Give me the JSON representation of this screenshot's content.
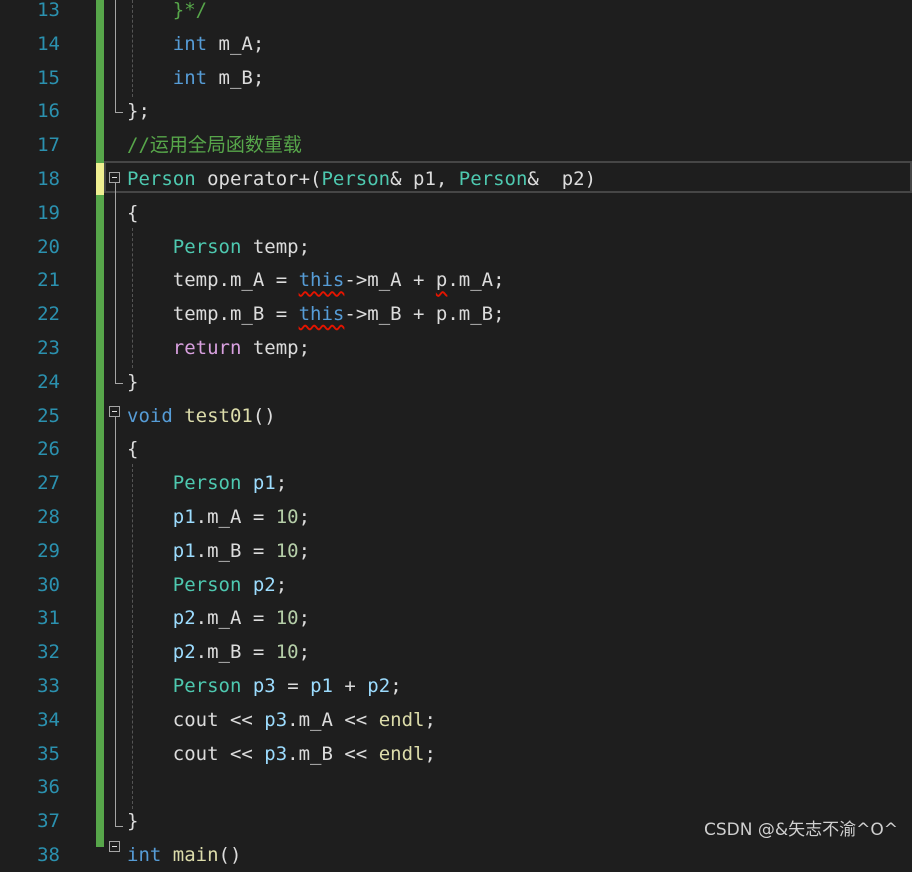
{
  "line_numbers": [
    "13",
    "14",
    "15",
    "16",
    "17",
    "18",
    "19",
    "20",
    "21",
    "22",
    "23",
    "24",
    "25",
    "26",
    "27",
    "28",
    "29",
    "30",
    "31",
    "32",
    "33",
    "34",
    "35",
    "36",
    "37",
    "38"
  ],
  "lines": [
    [
      {
        "t": "    "
      },
      {
        "t": "}*/",
        "c": "cmt"
      }
    ],
    [
      {
        "t": "    "
      },
      {
        "t": "int",
        "c": "kw"
      },
      {
        "t": " m_A;"
      }
    ],
    [
      {
        "t": "    "
      },
      {
        "t": "int",
        "c": "kw"
      },
      {
        "t": " m_B;"
      }
    ],
    [
      {
        "t": "};"
      }
    ],
    [
      {
        "t": "//运用全局函数重载",
        "c": "cmt"
      }
    ],
    [
      {
        "t": "Person",
        "c": "type"
      },
      {
        "t": " operator+(",
        "c": "plain"
      },
      {
        "t": "Person",
        "c": "type"
      },
      {
        "t": "& p1, "
      },
      {
        "t": "Person",
        "c": "type"
      },
      {
        "t": "&  p2)"
      }
    ],
    [
      {
        "t": "{"
      }
    ],
    [
      {
        "t": "    "
      },
      {
        "t": "Person",
        "c": "type"
      },
      {
        "t": " temp;"
      }
    ],
    [
      {
        "t": "    "
      },
      {
        "t": "temp",
        "c": "plain"
      },
      {
        "t": ".m_A = "
      },
      {
        "t": "this",
        "c": "kw",
        "sq": true
      },
      {
        "t": "->m_A + "
      },
      {
        "t": "p",
        "sq": true
      },
      {
        "t": ".m_A;"
      }
    ],
    [
      {
        "t": "    "
      },
      {
        "t": "temp",
        "c": "plain"
      },
      {
        "t": ".m_B = "
      },
      {
        "t": "this",
        "c": "kw",
        "sq": true
      },
      {
        "t": "->m_B + p.m_B;"
      }
    ],
    [
      {
        "t": "    "
      },
      {
        "t": "return",
        "c": "ctl"
      },
      {
        "t": " temp;"
      }
    ],
    [
      {
        "t": "}"
      }
    ],
    [
      {
        "t": "void",
        "c": "kw"
      },
      {
        "t": " "
      },
      {
        "t": "test01",
        "c": "fn"
      },
      {
        "t": "()"
      }
    ],
    [
      {
        "t": "{"
      }
    ],
    [
      {
        "t": "    "
      },
      {
        "t": "Person",
        "c": "type"
      },
      {
        "t": " "
      },
      {
        "t": "p1",
        "c": "var"
      },
      {
        "t": ";"
      }
    ],
    [
      {
        "t": "    "
      },
      {
        "t": "p1",
        "c": "var"
      },
      {
        "t": ".m_A = "
      },
      {
        "t": "10",
        "c": "num"
      },
      {
        "t": ";"
      }
    ],
    [
      {
        "t": "    "
      },
      {
        "t": "p1",
        "c": "var"
      },
      {
        "t": ".m_B = "
      },
      {
        "t": "10",
        "c": "num"
      },
      {
        "t": ";"
      }
    ],
    [
      {
        "t": "    "
      },
      {
        "t": "Person",
        "c": "type"
      },
      {
        "t": " "
      },
      {
        "t": "p2",
        "c": "var"
      },
      {
        "t": ";"
      }
    ],
    [
      {
        "t": "    "
      },
      {
        "t": "p2",
        "c": "var"
      },
      {
        "t": ".m_A = "
      },
      {
        "t": "10",
        "c": "num"
      },
      {
        "t": ";"
      }
    ],
    [
      {
        "t": "    "
      },
      {
        "t": "p2",
        "c": "var"
      },
      {
        "t": ".m_B = "
      },
      {
        "t": "10",
        "c": "num"
      },
      {
        "t": ";"
      }
    ],
    [
      {
        "t": "    "
      },
      {
        "t": "Person",
        "c": "type"
      },
      {
        "t": " "
      },
      {
        "t": "p3",
        "c": "var"
      },
      {
        "t": " = "
      },
      {
        "t": "p1",
        "c": "var"
      },
      {
        "t": " + "
      },
      {
        "t": "p2",
        "c": "var"
      },
      {
        "t": ";"
      }
    ],
    [
      {
        "t": "    cout << "
      },
      {
        "t": "p3",
        "c": "var"
      },
      {
        "t": ".m_A << "
      },
      {
        "t": "endl",
        "c": "fn"
      },
      {
        "t": ";"
      }
    ],
    [
      {
        "t": "    cout << "
      },
      {
        "t": "p3",
        "c": "var"
      },
      {
        "t": ".m_B << "
      },
      {
        "t": "endl",
        "c": "fn"
      },
      {
        "t": ";"
      }
    ],
    [
      {
        "t": ""
      }
    ],
    [
      {
        "t": "}"
      }
    ],
    [
      {
        "t": "int",
        "c": "kw"
      },
      {
        "t": " "
      },
      {
        "t": "main",
        "c": "fn"
      },
      {
        "t": "()"
      }
    ]
  ],
  "watermark": "CSDN @&矢志不渝^O^",
  "colors": {
    "background": "#1e1e1e",
    "line_number": "#2b91af",
    "keyword": "#569cd6",
    "type": "#4ec9b0",
    "comment": "#57a64a",
    "change_saved": "#57a64a",
    "change_unsaved": "#efef91"
  }
}
